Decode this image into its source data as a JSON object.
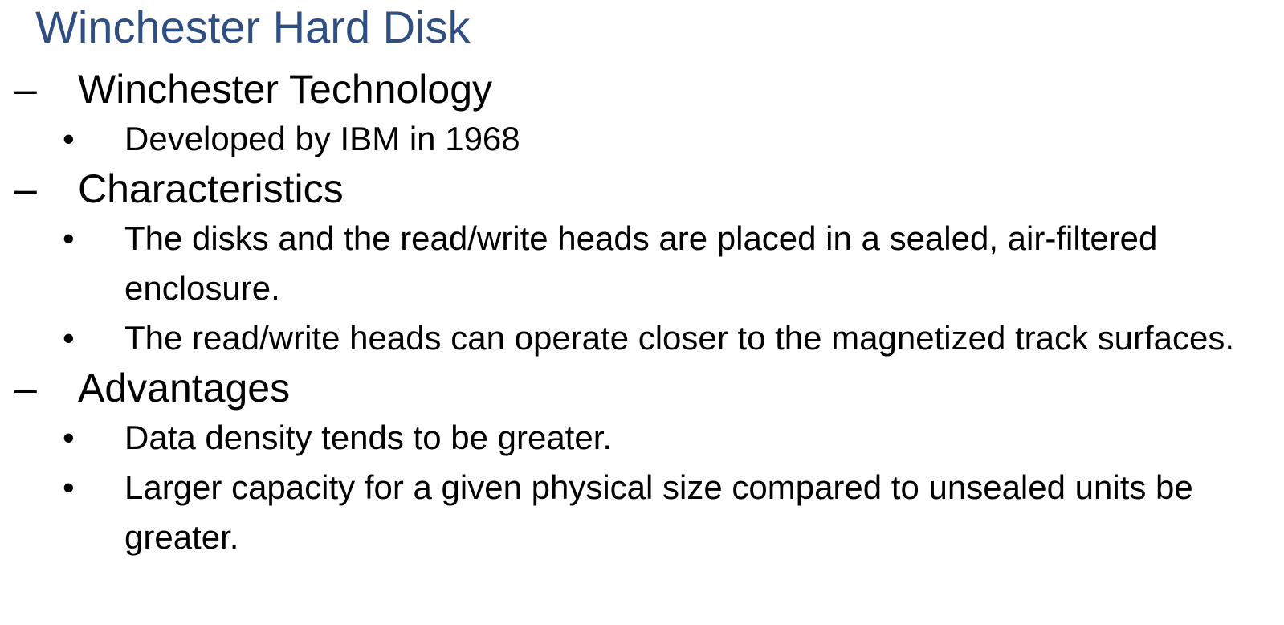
{
  "slide": {
    "title": "Winchester Hard Disk",
    "title_color": "#2f4f82",
    "sections": [
      {
        "marker": "–",
        "heading": "Winchester Technology",
        "bullets": [
          {
            "marker": "•",
            "text": "Developed by IBM in 1968"
          }
        ]
      },
      {
        "marker": "–",
        "heading": "Characteristics",
        "bullets": [
          {
            "marker": "•",
            "text": "The disks and the read/write heads are placed in a sealed, air-filtered enclosure."
          },
          {
            "marker": "•",
            "text": "The read/write heads can operate closer to the magnetized track surfaces."
          }
        ]
      },
      {
        "marker": "–",
        "heading": "Advantages",
        "bullets": [
          {
            "marker": "•",
            "text": "Data density tends to be greater."
          },
          {
            "marker": "•",
            "text": "Larger capacity for a given physical size compared to unsealed units be greater."
          }
        ]
      }
    ]
  }
}
